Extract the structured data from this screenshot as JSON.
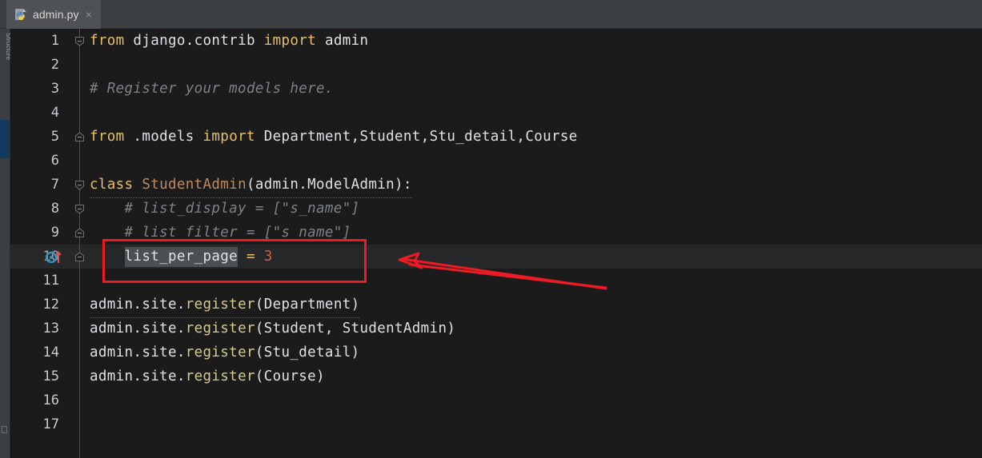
{
  "window": {
    "theme_background": "#1b1b1b",
    "chrome_background": "#3c3f41",
    "accent_annotation": "#ed1c24"
  },
  "tab_bar": {
    "tabs": [
      {
        "label": "admin.py",
        "icon": "python-file-icon",
        "close_label": "×",
        "active": true
      }
    ]
  },
  "tool_strip": {
    "label": "Structure"
  },
  "editor": {
    "current_line": 10,
    "gutter_icon": "override-method-icon",
    "selection_text": "list_per_page",
    "lines": [
      {
        "number": "1",
        "fold": "collapse-down",
        "indent": 0
      },
      {
        "number": "2",
        "fold": null,
        "indent": 0
      },
      {
        "number": "3",
        "fold": null,
        "indent": 0
      },
      {
        "number": "4",
        "fold": null,
        "indent": 0
      },
      {
        "number": "5",
        "fold": "collapse-up",
        "indent": 0
      },
      {
        "number": "6",
        "fold": null,
        "indent": 0
      },
      {
        "number": "7",
        "fold": "collapse-down",
        "indent": 0
      },
      {
        "number": "8",
        "fold": "collapse-down",
        "indent": 0
      },
      {
        "number": "9",
        "fold": "collapse-up",
        "indent": 0
      },
      {
        "number": "10",
        "fold": "collapse-up",
        "indent": 0
      },
      {
        "number": "11",
        "fold": null,
        "indent": 0
      },
      {
        "number": "12",
        "fold": null,
        "indent": 0
      },
      {
        "number": "13",
        "fold": null,
        "indent": 0
      },
      {
        "number": "14",
        "fold": null,
        "indent": 0
      },
      {
        "number": "15",
        "fold": null,
        "indent": 0
      },
      {
        "number": "16",
        "fold": null,
        "indent": 0
      },
      {
        "number": "17",
        "fold": null,
        "indent": 0
      }
    ],
    "source_plain": [
      "from django.contrib import admin",
      "",
      "# Register your models here.",
      "",
      "from .models import Department,Student,Stu_detail,Course",
      "",
      "class StudentAdmin(admin.ModelAdmin):",
      "    # list_display = [\"s_name\"]",
      "    # list_filter = [\"s_name\"]",
      "    list_per_page = 3",
      "",
      "admin.site.register(Department)",
      "admin.site.register(Student, StudentAdmin)",
      "admin.site.register(Stu_detail)",
      "admin.site.register(Course)",
      "",
      ""
    ],
    "tokens": {
      "l1": {
        "kw1": "from",
        "mod": " django.contrib ",
        "kw2": "import",
        "tail": " admin"
      },
      "l3": {
        "comment": "# Register your models here."
      },
      "l5": {
        "kw1": "from",
        "mod": " .models ",
        "kw2": "import",
        "tail": " Department,Student,Stu_detail,Course"
      },
      "l7": {
        "kw": "class",
        "name": " StudentAdmin",
        "tail": "(admin.ModelAdmin):"
      },
      "l8": {
        "comment": "    # list_display = [\"s_name\"]"
      },
      "l9": {
        "comment": "    # list_filter = [\"s_name\"]"
      },
      "l10": {
        "indent": "    ",
        "name": "list_per_page",
        "op": " = ",
        "num": "3"
      },
      "l12": {
        "obj": "admin.site.",
        "fn": "register",
        "args": "(Department)"
      },
      "l13": {
        "obj": "admin.site.",
        "fn": "register",
        "args": "(Student, StudentAdmin)"
      },
      "l14": {
        "obj": "admin.site.",
        "fn": "register",
        "args": "(Stu_detail)"
      },
      "l15": {
        "obj": "admin.site.",
        "fn": "register",
        "args": "(Course)"
      }
    }
  },
  "annotations": {
    "highlight_box": {
      "target_line": "10",
      "color": "#ed1c24"
    },
    "arrow": {
      "direction": "left",
      "color": "#ed1c24"
    }
  }
}
